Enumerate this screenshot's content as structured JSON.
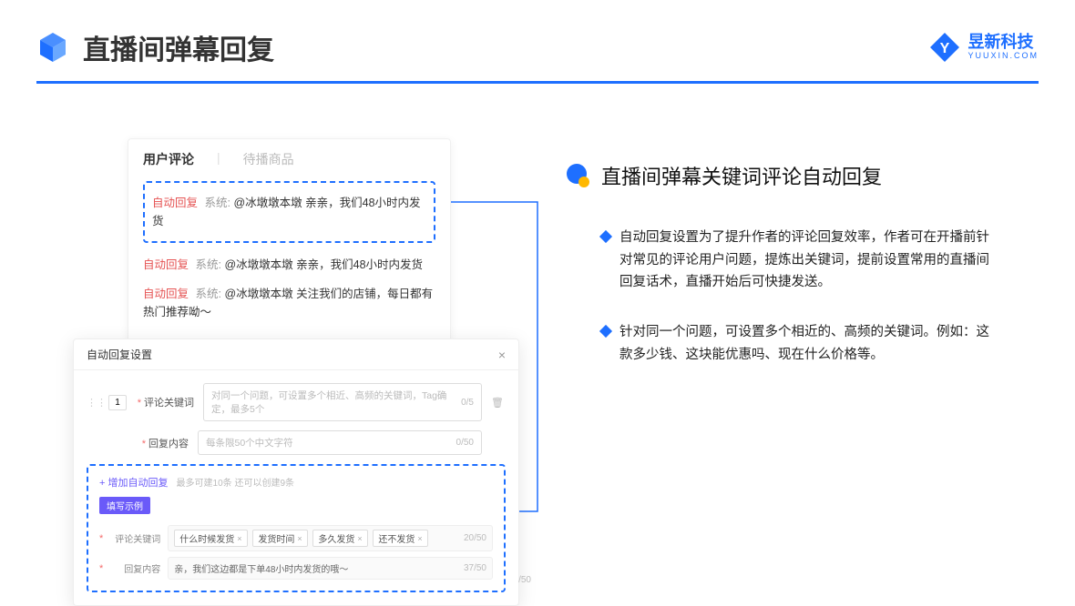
{
  "header": {
    "title": "直播间弹幕回复"
  },
  "brand": {
    "name": "昱新科技",
    "url": "YUUXIN.COM"
  },
  "comments_card": {
    "tab_active": "用户评论",
    "tab_inactive": "待播商品",
    "rows": [
      {
        "auto": "自动回复",
        "sys": "系统:",
        "text": "@冰墩墩本墩 亲亲，我们48小时内发货"
      },
      {
        "auto": "自动回复",
        "sys": "系统:",
        "text": "@冰墩墩本墩 亲亲，我们48小时内发货"
      },
      {
        "auto": "自动回复",
        "sys": "系统:",
        "text": "@冰墩墩本墩 关注我们的店铺，每日都有热门推荐呦～"
      }
    ]
  },
  "modal": {
    "title": "自动回复设置",
    "index": "1",
    "keyword_label": "评论关键词",
    "keyword_placeholder": "对同一个问题，可设置多个相近、高频的关键词，Tag确定，最多5个",
    "keyword_counter": "0/5",
    "reply_label": "回复内容",
    "reply_placeholder": "每条限50个中文字符",
    "reply_counter": "0/50",
    "add_link": "+ 增加自动回复",
    "add_hint": "最多可建10条 还可以创建9条",
    "example_badge": "填写示例",
    "ex_keyword_label": "评论关键词",
    "ex_tags": [
      "什么时候发货",
      "发货时间",
      "多久发货",
      "还不发货"
    ],
    "ex_kw_counter": "20/50",
    "ex_reply_label": "回复内容",
    "ex_reply_text": "亲，我们这边都是下单48小时内发货的哦～",
    "ex_reply_counter": "37/50",
    "side_counter": "/50"
  },
  "right": {
    "section_title": "直播间弹幕关键词评论自动回复",
    "bullets": [
      "自动回复设置为了提升作者的评论回复效率，作者可在开播前针对常见的评论用户问题，提炼出关键词，提前设置常用的直播间回复话术，直播开始后可快捷发送。",
      "针对同一个问题，可设置多个相近的、高频的关键词。例如：这款多少钱、这块能优惠吗、现在什么价格等。"
    ]
  }
}
